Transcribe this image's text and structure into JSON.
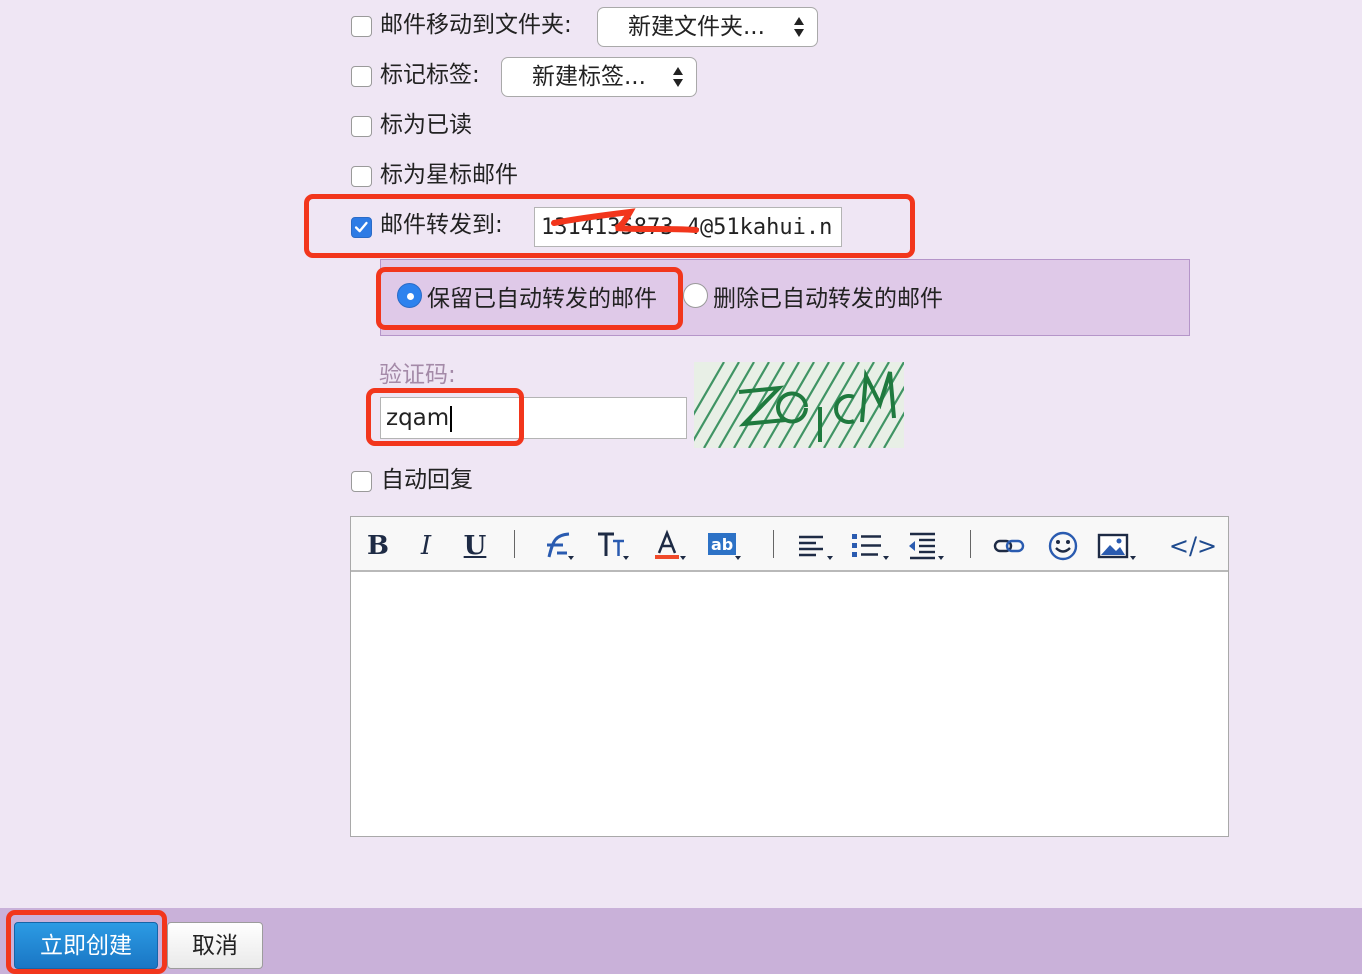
{
  "rules": {
    "move_to_folder": {
      "label": "邮件移动到文件夹:",
      "checked": false,
      "select_value": "新建文件夹..."
    },
    "mark_tag": {
      "label": "标记标签:",
      "checked": false,
      "select_value": "新建标签..."
    },
    "mark_read": {
      "label": "标为已读",
      "checked": false
    },
    "mark_star": {
      "label": "标为星标邮件",
      "checked": false
    },
    "forward": {
      "label": "邮件转发到:",
      "checked": true,
      "email": "1314135873 4@51kahui.n"
    },
    "keep_forwarded": {
      "label": "保留已自动转发的邮件",
      "selected": true
    },
    "delete_forwarded": {
      "label": "删除已自动转发的邮件",
      "selected": false
    },
    "auto_reply": {
      "label": "自动回复",
      "checked": false
    }
  },
  "captcha": {
    "label": "验证码:",
    "value": "zqam",
    "image_text": "ZqcM"
  },
  "editor": {
    "toolbar": {
      "bold": "B",
      "italic": "I",
      "underline": "U",
      "source": "</>"
    },
    "content": ""
  },
  "footer": {
    "create_button": "立即创建",
    "cancel_button": "取消"
  },
  "colors": {
    "page_bg": "#efe6f4",
    "footer_bg": "#c9b1d9",
    "highlight": "#f2361c",
    "primary_button": "#2086d4",
    "radio_panel_bg": "#dfc9e8"
  }
}
